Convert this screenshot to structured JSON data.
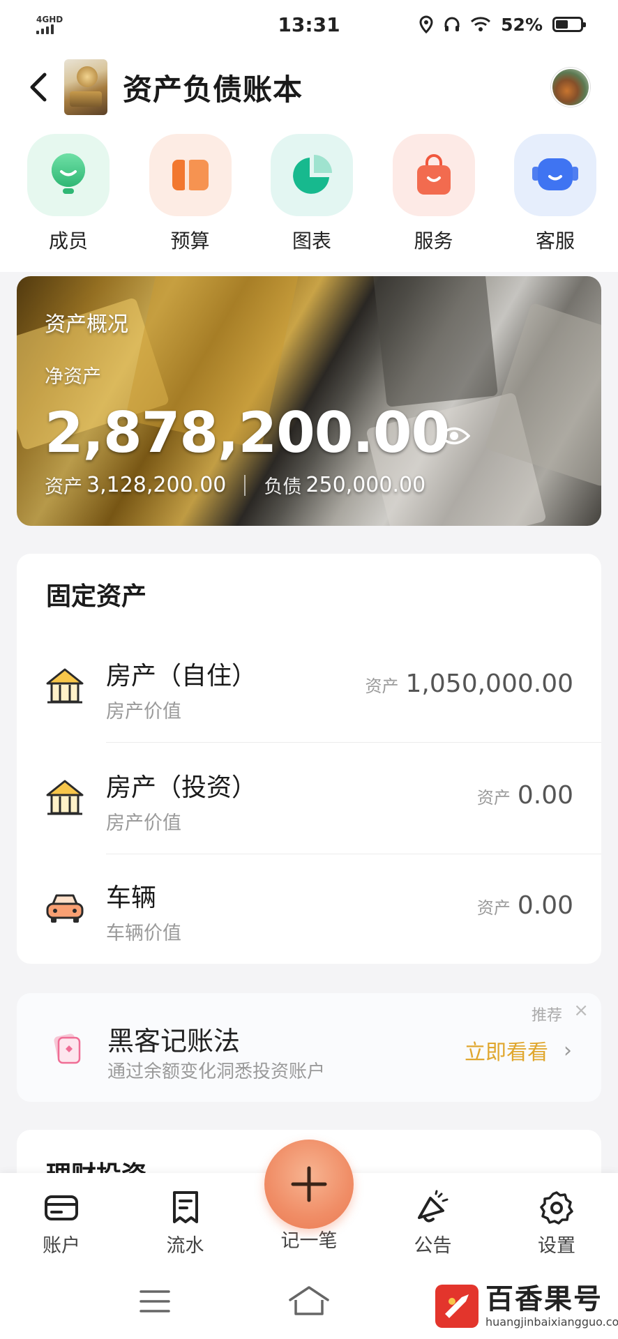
{
  "status_bar": {
    "network": "4GHD",
    "time": "13:31",
    "battery": "52%"
  },
  "header": {
    "title": "资产负债账本"
  },
  "quick_menu": [
    {
      "label": "成员",
      "icon": "member-icon"
    },
    {
      "label": "预算",
      "icon": "budget-icon"
    },
    {
      "label": "图表",
      "icon": "pie-chart-icon"
    },
    {
      "label": "服务",
      "icon": "shopping-bag-icon"
    },
    {
      "label": "客服",
      "icon": "robot-icon"
    }
  ],
  "asset_banner": {
    "title": "资产概况",
    "net_label": "净资产",
    "net_value": "2,878,200.00",
    "assets_label": "资产",
    "assets_value": "3,128,200.00",
    "liabilities_label": "负债",
    "liabilities_value": "250,000.00"
  },
  "fixed_assets": {
    "title": "固定资产",
    "rows": [
      {
        "name": "房产（自住）",
        "sub": "房产价值",
        "amount_label": "资产",
        "amount": "1,050,000.00",
        "icon": "house-icon"
      },
      {
        "name": "房产（投资）",
        "sub": "房产价值",
        "amount_label": "资产",
        "amount": "0.00",
        "icon": "house-icon"
      },
      {
        "name": "车辆",
        "sub": "车辆价值",
        "amount_label": "资产",
        "amount": "0.00",
        "icon": "car-icon"
      }
    ]
  },
  "promo": {
    "tag": "推荐",
    "close": "×",
    "title": "黑客记账法",
    "subtitle": "通过余额变化洞悉投资账户",
    "action": "立即看看",
    "chevron": "›"
  },
  "wealth": {
    "title": "理财投资"
  },
  "bottom_nav": {
    "items": [
      {
        "label": "账户",
        "icon": "card-icon"
      },
      {
        "label": "流水",
        "icon": "receipt-icon"
      },
      {
        "label": "记一笔",
        "icon": "plus-icon"
      },
      {
        "label": "公告",
        "icon": "announcement-icon"
      },
      {
        "label": "设置",
        "icon": "gear-icon"
      }
    ]
  },
  "watermark": {
    "cn": "百香果号",
    "en": "huangjinbaixiangguo.com"
  },
  "colors": {
    "accent_orange": "#f08d66",
    "action_gold": "#e0a72e",
    "background": "#f4f4f6"
  }
}
